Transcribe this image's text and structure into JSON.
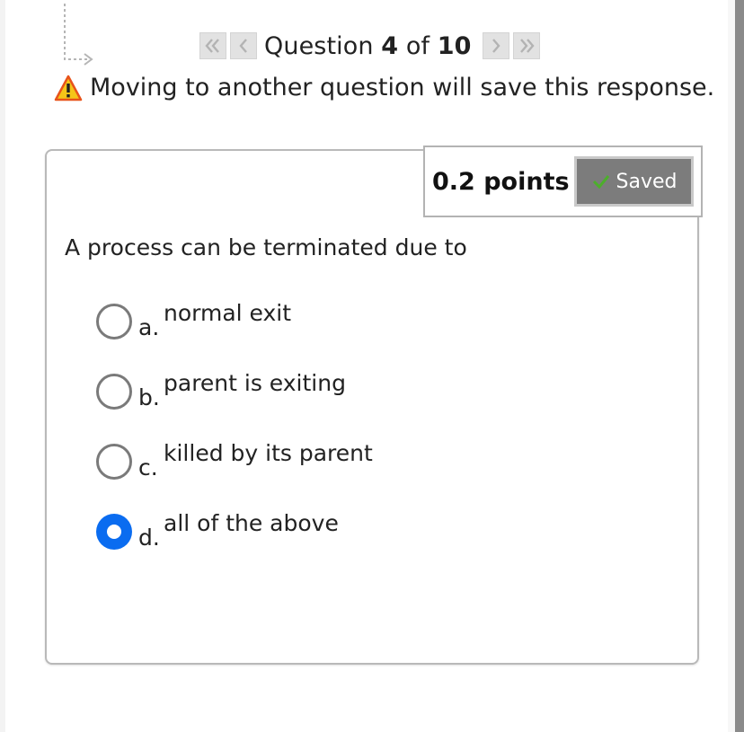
{
  "navigation": {
    "first_icon": "double-chevron-left-icon",
    "prev_icon": "chevron-left-icon",
    "next_icon": "chevron-right-icon",
    "last_icon": "double-chevron-right-icon",
    "question_prefix": "Question ",
    "current": "4",
    "of_label": " of ",
    "total": "10"
  },
  "warning": {
    "icon": "warning-icon",
    "text": "Moving to another question will save this response."
  },
  "question": {
    "points": "0.2 points",
    "saved_label": "Saved",
    "saved_icon": "checkmark-icon",
    "prompt": "A process can be terminated due to",
    "options": [
      {
        "letter": "a.",
        "text": "normal exit",
        "selected": false
      },
      {
        "letter": "b.",
        "text": "parent is exiting",
        "selected": false
      },
      {
        "letter": "c.",
        "text": "killed by its parent",
        "selected": false
      },
      {
        "letter": "d.",
        "text": "all of the above",
        "selected": true
      }
    ]
  },
  "colors": {
    "accent": "#0a6cf0",
    "saved_bg": "#7c7c7c",
    "warning_yellow": "#f5c518",
    "warning_orange": "#e8531b",
    "check_green": "#4caf2b"
  }
}
